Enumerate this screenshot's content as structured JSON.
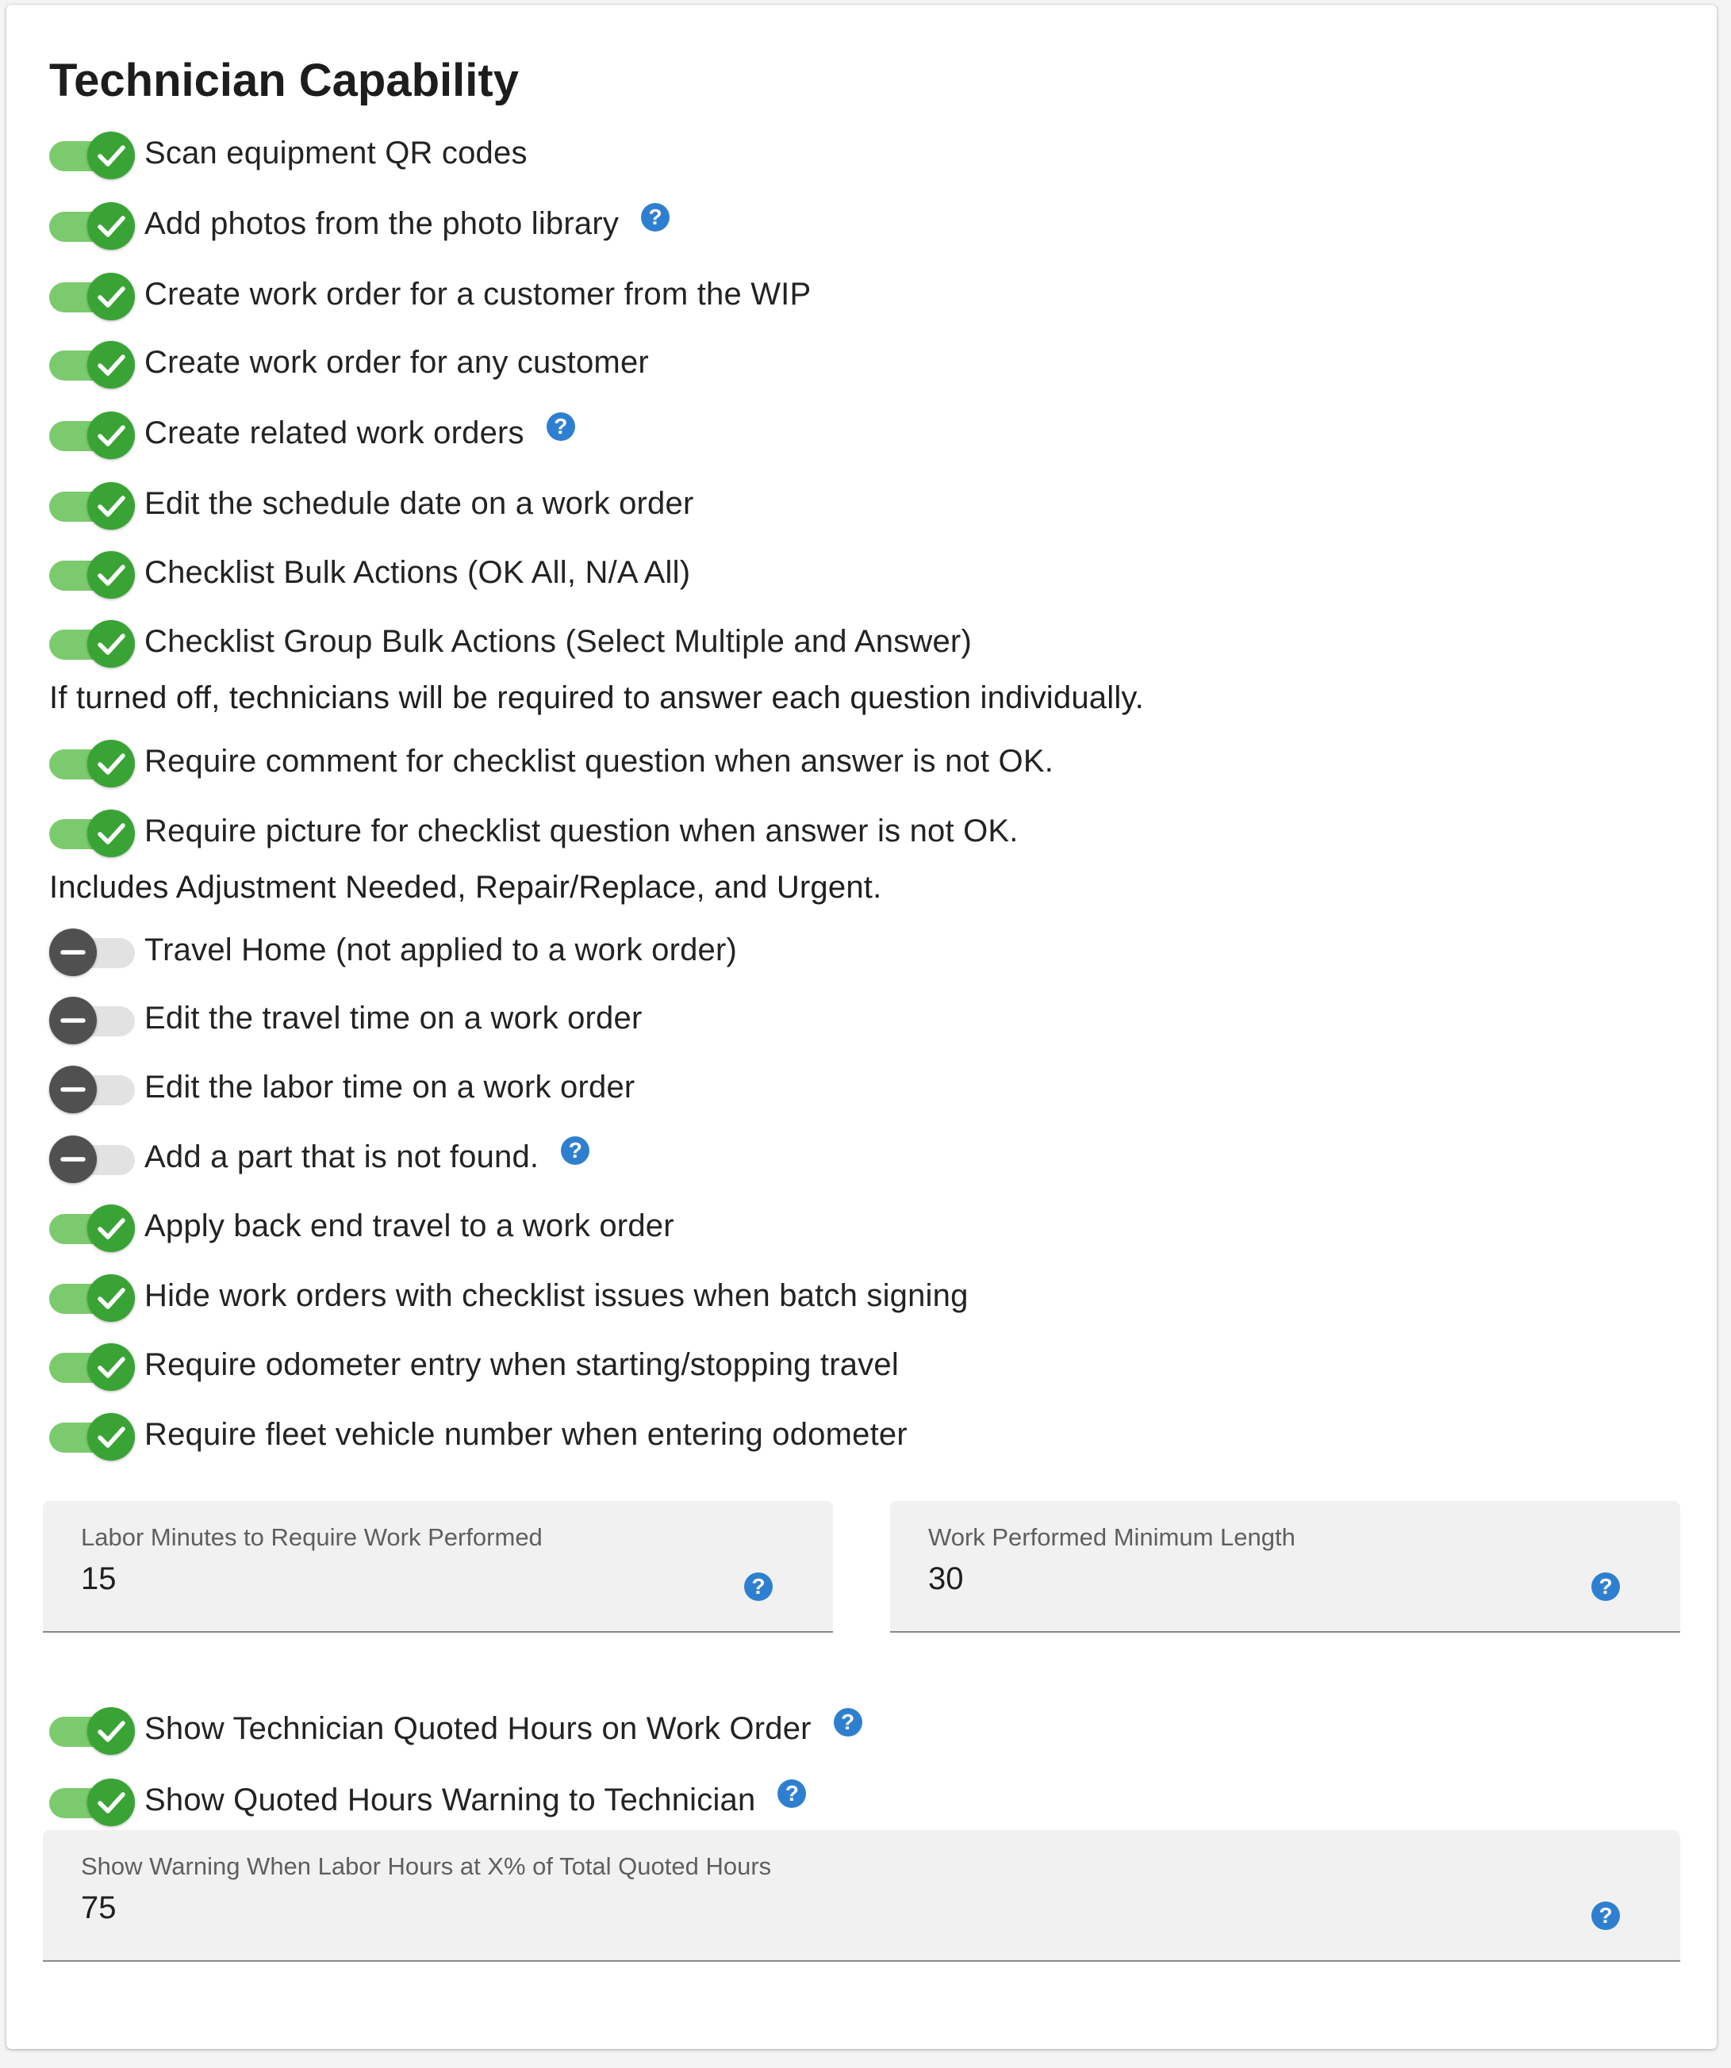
{
  "title": "Technician Capability",
  "colors": {
    "toggle_on_knob": "#3aa335",
    "toggle_on_track": "#7cca6e",
    "toggle_off_knob": "#505050",
    "toggle_off_track": "#e2e2e2",
    "help_icon": "#2f7fd0"
  },
  "settings": [
    {
      "label": "Scan equipment QR codes",
      "enabled": true,
      "help": false
    },
    {
      "label": "Add photos from the photo library",
      "enabled": true,
      "help": true
    },
    {
      "label": "Create work order for a customer from the WIP",
      "enabled": true,
      "help": false
    },
    {
      "label": "Create work order for any customer",
      "enabled": true,
      "help": false
    },
    {
      "label": "Create related work orders",
      "enabled": true,
      "help": true
    },
    {
      "label": "Edit the schedule date on a work order",
      "enabled": true,
      "help": false
    },
    {
      "label": "Checklist Bulk Actions (OK All, N/A All)",
      "enabled": true,
      "help": false
    },
    {
      "label": "Checklist Group Bulk Actions (Select Multiple and Answer)",
      "enabled": true,
      "help": false
    },
    {
      "label": "Require comment for checklist question when answer is not OK.",
      "enabled": true,
      "help": false
    },
    {
      "label": "Require picture for checklist question when answer is not OK.",
      "enabled": true,
      "help": false
    },
    {
      "label": "Travel Home (not applied to a work order)",
      "enabled": false,
      "help": false
    },
    {
      "label": "Edit the travel time on a work order",
      "enabled": false,
      "help": false
    },
    {
      "label": "Edit the labor time on a work order",
      "enabled": false,
      "help": false
    },
    {
      "label": "Add a part that is not found.",
      "enabled": false,
      "help": true
    },
    {
      "label": "Apply back end travel to a work order",
      "enabled": true,
      "help": false
    },
    {
      "label": "Hide work orders with checklist issues when batch signing",
      "enabled": true,
      "help": false
    },
    {
      "label": "Require odometer entry when starting/stopping travel",
      "enabled": true,
      "help": false
    },
    {
      "label": "Require fleet vehicle number when entering odometer",
      "enabled": true,
      "help": false
    },
    {
      "label": "Show Technician Quoted Hours on Work Order",
      "enabled": true,
      "help": true
    },
    {
      "label": "Show Quoted Hours Warning to Technician",
      "enabled": true,
      "help": true
    }
  ],
  "notes": {
    "group_bulk": "If turned off, technicians will be required to answer each question individually.",
    "picture": "Includes Adjustment Needed, Repair/Replace, and Urgent."
  },
  "fields": {
    "labor_minutes": {
      "label": "Labor Minutes to Require Work Performed",
      "value": "15"
    },
    "work_performed_length": {
      "label": "Work Performed Minimum Length",
      "value": "30"
    },
    "warning_percent": {
      "label": "Show Warning When Labor Hours at X% of Total Quoted Hours",
      "value": "75"
    }
  },
  "help_glyph": "?"
}
